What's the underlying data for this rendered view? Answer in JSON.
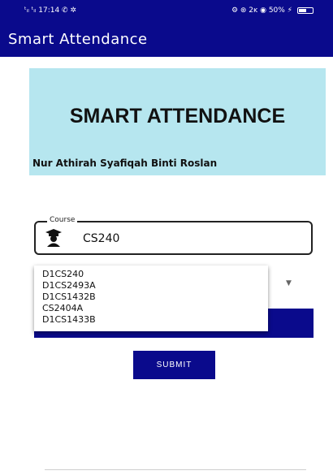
{
  "status_bar": {
    "left_text": "ᵗᵢₗ ᵗᵢₗ 17:14  ✆ ✲",
    "right_text": "⚙ ⊛ 2ᴋ ◉  50% ⚡"
  },
  "app_bar": {
    "title": "Smart Attendance"
  },
  "hero": {
    "title": "SMART ATTENDANCE",
    "name": "Nur Athirah Syafiqah Binti Roslan"
  },
  "course_field": {
    "label": "Course",
    "value": "CS240",
    "icon": "student-icon"
  },
  "dropdown": {
    "items": [
      "D1CS240",
      "D1CS2493A",
      "D1CS1432B",
      "CS2404A",
      "D1CS1433B"
    ]
  },
  "submit": {
    "label": "SUBMIT"
  },
  "colors": {
    "primary": "#0a0a8c",
    "hero_bg": "#b6e6ef"
  }
}
